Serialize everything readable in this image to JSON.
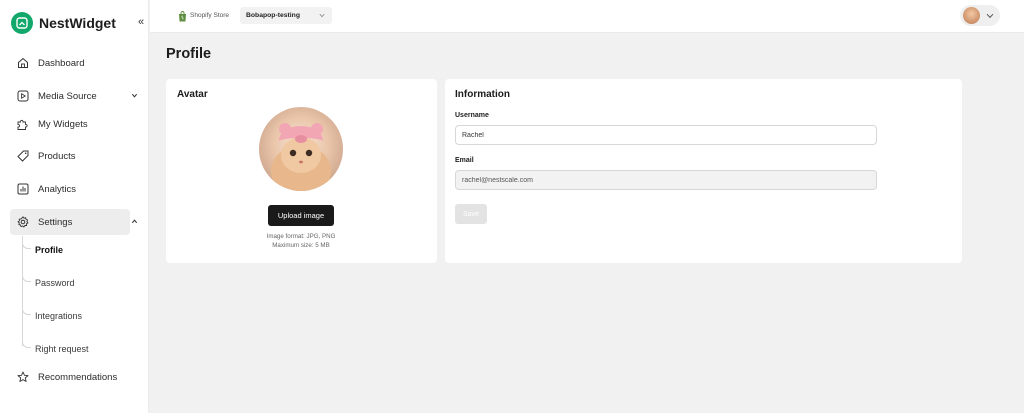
{
  "brand": {
    "name": "NestWidget"
  },
  "sidebar": {
    "collapse_glyph": "«",
    "items": [
      {
        "label": "Dashboard",
        "icon": "home-icon"
      },
      {
        "label": "Media Source",
        "icon": "play-icon"
      },
      {
        "label": "My Widgets",
        "icon": "puzzle-icon"
      },
      {
        "label": "Products",
        "icon": "tag-icon"
      },
      {
        "label": "Analytics",
        "icon": "chart-icon"
      },
      {
        "label": "Settings",
        "icon": "gear-icon"
      },
      {
        "label": "Recommendations",
        "icon": "star-icon"
      }
    ],
    "settings_children": [
      "Profile",
      "Password",
      "Integrations",
      "Right request"
    ],
    "active_item": "Settings",
    "active_child": "Profile"
  },
  "topbar": {
    "store_label": "Shopify Store",
    "store_value": "Bobapop-testing"
  },
  "page": {
    "title": "Profile"
  },
  "avatar_card": {
    "title": "Avatar",
    "upload_label": "Upload image",
    "format_hint": "Image format: JPG, PNG",
    "size_hint": "Maximum size: 5 MB"
  },
  "info_card": {
    "title": "Information",
    "username_label": "Username",
    "username_value": "Rachel",
    "email_label": "Email",
    "email_value": "rachel@nestscale.com",
    "save_label": "Save"
  },
  "colors": {
    "brand_green": "#13a86b",
    "dark_button": "#1a1a1a",
    "background": "#f1f1f1"
  }
}
